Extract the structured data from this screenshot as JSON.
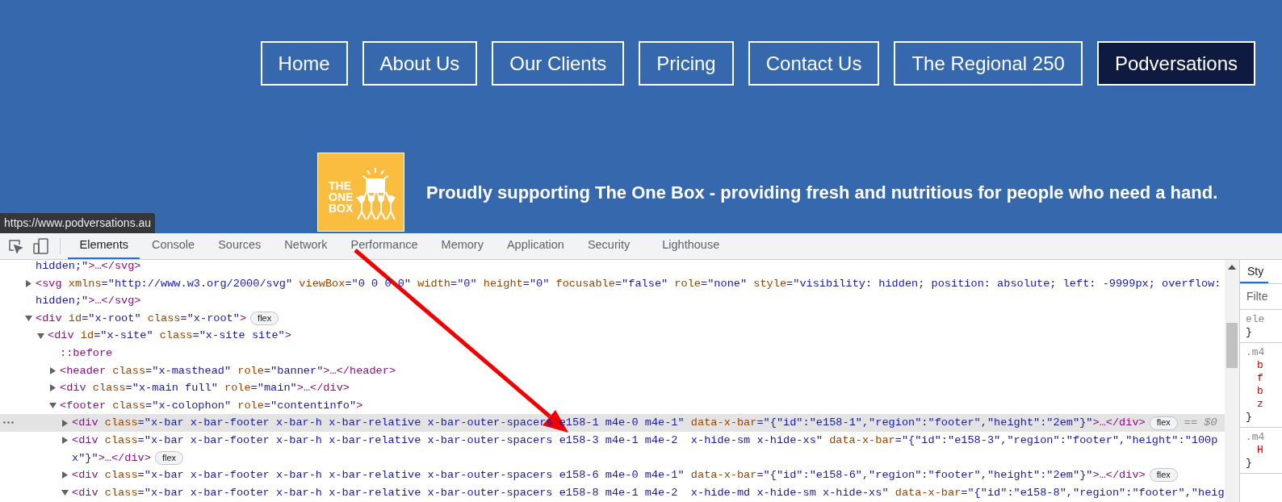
{
  "site": {
    "nav": [
      {
        "label": "Home",
        "selected": false
      },
      {
        "label": "About Us",
        "selected": false
      },
      {
        "label": "Our Clients",
        "selected": false
      },
      {
        "label": "Pricing",
        "selected": false
      },
      {
        "label": "Contact Us",
        "selected": false
      },
      {
        "label": "The Regional 250",
        "selected": false
      },
      {
        "label": "Podversations",
        "selected": true
      }
    ],
    "logo": {
      "words": [
        "THE",
        "ONE",
        "BOX"
      ]
    },
    "tagline": "Proudly supporting The One Box - providing fresh and nutritious for people who need a hand.",
    "link_preview": "https://www.podversations.au"
  },
  "devtools": {
    "tabs": [
      {
        "label": "Elements",
        "selected": true
      },
      {
        "label": "Console",
        "selected": false
      },
      {
        "label": "Sources",
        "selected": false
      },
      {
        "label": "Network",
        "selected": false
      },
      {
        "label": "Performance",
        "selected": false
      },
      {
        "label": "Memory",
        "selected": false
      },
      {
        "label": "Application",
        "selected": false
      },
      {
        "label": "Security",
        "selected": false
      },
      {
        "label": "Lighthouse",
        "selected": false
      }
    ],
    "dom_tree": [
      {
        "selected": false,
        "lines": [
          [
            {
              "kind": "value",
              "text": "hidden;\""
            },
            {
              "kind": "tag",
              "text": ">…</svg>"
            }
          ]
        ]
      },
      {
        "selected": false,
        "expanded": false,
        "lines": [
          [
            {
              "kind": "tag",
              "text": "<svg"
            },
            {
              "kind": "attr",
              "text": " xmlns"
            },
            {
              "kind": "value",
              "text": "=\"http://www.w3.org/2000/svg\""
            },
            {
              "kind": "attr",
              "text": " viewBox"
            },
            {
              "kind": "value",
              "text": "=\"0 0 0 0\""
            },
            {
              "kind": "attr",
              "text": " width"
            },
            {
              "kind": "value",
              "text": "=\"0\""
            },
            {
              "kind": "attr",
              "text": " height"
            },
            {
              "kind": "value",
              "text": "=\"0\""
            },
            {
              "kind": "attr",
              "text": " focusable"
            },
            {
              "kind": "value",
              "text": "=\"false\""
            },
            {
              "kind": "attr",
              "text": " role"
            },
            {
              "kind": "value",
              "text": "=\"none\""
            },
            {
              "kind": "attr",
              "text": " style"
            },
            {
              "kind": "value",
              "text": "=\"visibility: hidden; position: absolute; left: -9999px; overflow:"
            }
          ],
          [
            {
              "kind": "value",
              "text": "hidden;\""
            },
            {
              "kind": "tag",
              "text": ">…</svg>"
            }
          ]
        ]
      },
      {
        "selected": false,
        "expanded": true,
        "badge": "flex",
        "lines": [
          [
            {
              "kind": "tag",
              "text": "<div"
            },
            {
              "kind": "attr",
              "text": " id"
            },
            {
              "kind": "value",
              "text": "=\"x-root\""
            },
            {
              "kind": "attr",
              "text": " class"
            },
            {
              "kind": "value",
              "text": "=\"x-root\""
            },
            {
              "kind": "tag",
              "text": ">"
            }
          ]
        ],
        "children": [
          {
            "selected": false,
            "expanded": true,
            "lines": [
              [
                {
                  "kind": "tag",
                  "text": "<div"
                },
                {
                  "kind": "attr",
                  "text": " id"
                },
                {
                  "kind": "value",
                  "text": "=\"x-site\""
                },
                {
                  "kind": "attr",
                  "text": " class"
                },
                {
                  "kind": "value",
                  "text": "=\"x-site site\""
                },
                {
                  "kind": "tag",
                  "text": ">"
                }
              ]
            ],
            "children": [
              {
                "selected": false,
                "lines": [
                  [
                    {
                      "kind": "tag",
                      "text": "::before"
                    }
                  ]
                ]
              },
              {
                "selected": false,
                "expanded": false,
                "lines": [
                  [
                    {
                      "kind": "tag",
                      "text": "<header"
                    },
                    {
                      "kind": "attr",
                      "text": " class"
                    },
                    {
                      "kind": "value",
                      "text": "=\"x-masthead\""
                    },
                    {
                      "kind": "attr",
                      "text": " role"
                    },
                    {
                      "kind": "value",
                      "text": "=\"banner\""
                    },
                    {
                      "kind": "tag",
                      "text": ">…</header>"
                    }
                  ]
                ]
              },
              {
                "selected": false,
                "expanded": false,
                "lines": [
                  [
                    {
                      "kind": "tag",
                      "text": "<div"
                    },
                    {
                      "kind": "attr",
                      "text": " class"
                    },
                    {
                      "kind": "value",
                      "text": "=\"x-main full\""
                    },
                    {
                      "kind": "attr",
                      "text": " role"
                    },
                    {
                      "kind": "value",
                      "text": "=\"main\""
                    },
                    {
                      "kind": "tag",
                      "text": ">…</div>"
                    }
                  ]
                ]
              },
              {
                "selected": false,
                "expanded": true,
                "lines": [
                  [
                    {
                      "kind": "tag",
                      "text": "<footer"
                    },
                    {
                      "kind": "attr",
                      "text": " class"
                    },
                    {
                      "kind": "value",
                      "text": "=\"x-colophon\""
                    },
                    {
                      "kind": "attr",
                      "text": " role"
                    },
                    {
                      "kind": "value",
                      "text": "=\"contentinfo\""
                    },
                    {
                      "kind": "tag",
                      "text": ">"
                    }
                  ]
                ],
                "children": [
                  {
                    "selected": true,
                    "expanded": false,
                    "badge": "flex",
                    "marker": "== $0",
                    "lines": [
                      [
                        {
                          "kind": "tag",
                          "text": "<div"
                        },
                        {
                          "kind": "attr",
                          "text": " class"
                        },
                        {
                          "kind": "value",
                          "text": "=\"x-bar x-bar-footer x-bar-h x-bar-relative x-bar-outer-spacers e158-1 m4e-0 m4e-1\""
                        },
                        {
                          "kind": "attr",
                          "text": " data-x-bar"
                        },
                        {
                          "kind": "value",
                          "text": "=\"{\"id\":\"e158-1\",\"region\":\"footer\",\"height\":\"2em\"}\""
                        },
                        {
                          "kind": "tag",
                          "text": ">…</div>"
                        }
                      ]
                    ]
                  },
                  {
                    "selected": false,
                    "expanded": false,
                    "badge": "flex",
                    "lines": [
                      [
                        {
                          "kind": "tag",
                          "text": "<div"
                        },
                        {
                          "kind": "attr",
                          "text": " class"
                        },
                        {
                          "kind": "value",
                          "text": "=\"x-bar x-bar-footer x-bar-h x-bar-relative x-bar-outer-spacers e158-3 m4e-1 m4e-2  x-hide-sm x-hide-xs\""
                        },
                        {
                          "kind": "attr",
                          "text": " data-x-bar"
                        },
                        {
                          "kind": "value",
                          "text": "=\"{\"id\":\"e158-3\",\"region\":\"footer\",\"height\":\"100p"
                        }
                      ],
                      [
                        {
                          "kind": "value",
                          "text": "x\"}\""
                        },
                        {
                          "kind": "tag",
                          "text": ">…</div>"
                        }
                      ]
                    ]
                  },
                  {
                    "selected": false,
                    "expanded": false,
                    "badge": "flex",
                    "lines": [
                      [
                        {
                          "kind": "tag",
                          "text": "<div"
                        },
                        {
                          "kind": "attr",
                          "text": " class"
                        },
                        {
                          "kind": "value",
                          "text": "=\"x-bar x-bar-footer x-bar-h x-bar-relative x-bar-outer-spacers e158-6 m4e-0 m4e-1\""
                        },
                        {
                          "kind": "attr",
                          "text": " data-x-bar"
                        },
                        {
                          "kind": "value",
                          "text": "=\"{\"id\":\"e158-6\",\"region\":\"footer\",\"height\":\"2em\"}\""
                        },
                        {
                          "kind": "tag",
                          "text": ">…</div>"
                        }
                      ]
                    ]
                  },
                  {
                    "selected": false,
                    "expanded": true,
                    "lines": [
                      [
                        {
                          "kind": "tag",
                          "text": "<div"
                        },
                        {
                          "kind": "attr",
                          "text": " class"
                        },
                        {
                          "kind": "value",
                          "text": "=\"x-bar x-bar-footer x-bar-h x-bar-relative x-bar-outer-spacers e158-8 m4e-1 m4e-2  x-hide-md x-hide-sm x-hide-xs\""
                        },
                        {
                          "kind": "attr",
                          "text": " data-x-bar"
                        },
                        {
                          "kind": "value",
                          "text": "=\"{\"id\":\"e158-8\",\"region\":\"footer\",\"heig"
                        }
                      ]
                    ]
                  }
                ]
              }
            ]
          }
        ]
      }
    ],
    "styles_pane": {
      "tab": "Sty",
      "filter_placeholder": "Filte",
      "rules": [
        {
          "selector": "ele",
          "close": "}"
        },
        {
          "selector": ".m4",
          "properties": [
            "b",
            "f",
            "b",
            "z"
          ],
          "close": "}"
        },
        {
          "selector": ".m4",
          "properties": [
            "H"
          ],
          "close": "}"
        }
      ]
    }
  }
}
